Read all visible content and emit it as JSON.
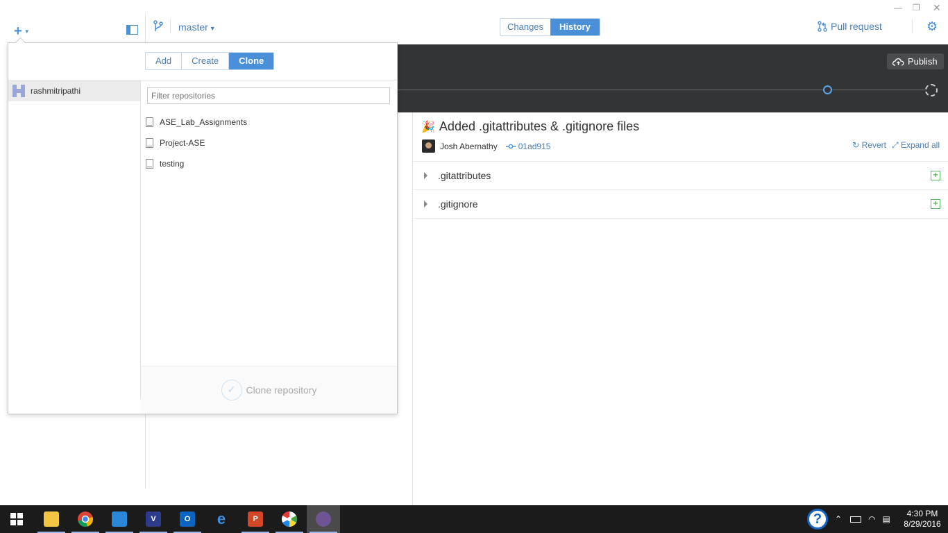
{
  "topbar": {
    "branch": "master",
    "tabs": [
      {
        "label": "Changes",
        "active": false
      },
      {
        "label": "History",
        "active": true
      }
    ],
    "pull_request": "Pull request",
    "window_controls": [
      "minimize",
      "restore",
      "close"
    ]
  },
  "timeline": {
    "publish_label": "Publish"
  },
  "commit": {
    "title": "Added .gitattributes & .gitignore files",
    "author": "Josh Abernathy",
    "sha": "01ad915",
    "revert_label": "Revert",
    "expand_label": "Expand all",
    "files": [
      {
        "name": ".gitattributes",
        "status": "added"
      },
      {
        "name": ".gitignore",
        "status": "added"
      }
    ]
  },
  "popover": {
    "tabs": [
      {
        "label": "Add",
        "active": false
      },
      {
        "label": "Create",
        "active": false
      },
      {
        "label": "Clone",
        "active": true
      }
    ],
    "account": "rashmitripathi",
    "filter_placeholder": "Filter repositories",
    "repositories": [
      "ASE_Lab_Assignments",
      "Project-ASE",
      "testing"
    ],
    "clone_button": "Clone repository"
  },
  "taskbar": {
    "apps": [
      "start",
      "file-explorer",
      "chrome",
      "remote-desktop",
      "visual-studio",
      "outlook",
      "edge",
      "powerpoint",
      "picasa",
      "github-desktop"
    ],
    "time": "4:30 PM",
    "date": "8/29/2016"
  },
  "colors": {
    "accent": "#4a90d9",
    "dark_bar": "#333436",
    "added_green": "#5ab85a"
  }
}
